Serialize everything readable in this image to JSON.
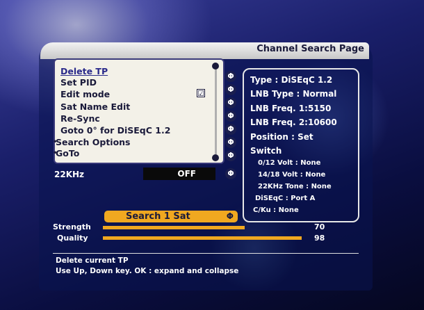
{
  "header": {
    "title": "Channel Search Page"
  },
  "menu": {
    "items": [
      {
        "label": "Delete TP"
      },
      {
        "label": "Set PID"
      },
      {
        "label": "Edit mode"
      },
      {
        "label": "Sat Name Edit"
      },
      {
        "label": "Re-Sync"
      },
      {
        "label": "Goto 0° for DiSEqC 1.2"
      },
      {
        "label": "Search Options"
      },
      {
        "label": "GoTo"
      }
    ],
    "edit_mode_check": "☑"
  },
  "right_icons": [
    "Φ",
    "Φ",
    "Φ",
    "Φ",
    "Φ",
    "Φ",
    "Φ",
    "Φ"
  ],
  "info": {
    "type": "Type : DiSEqC 1.2",
    "lnb_type": "LNB Type : Normal",
    "lnb_freq1": "LNB Freq. 1:5150",
    "lnb_freq2": "LNB Freq. 2:10600",
    "position": "Position : Set",
    "switch": "Switch",
    "switch_items": {
      "v012": "0/12 Volt : None",
      "v1418": "14/18 Volt : None",
      "tone": "22KHz Tone : None",
      "diseqc": "DiSEqC : Port A",
      "cku": "C/Ku : None"
    }
  },
  "khz": {
    "label": "22KHz",
    "value": "OFF"
  },
  "search": {
    "label": "Search 1 Sat",
    "icon": "Φ"
  },
  "strength": {
    "label": "Strength",
    "value": "70",
    "level": 0.7
  },
  "quality": {
    "label": "Quality",
    "value": "98",
    "level": 0.98
  },
  "help": {
    "line1": "Delete current TP",
    "line2": "Use Up, Down key. OK : expand and collapse"
  },
  "colors": {
    "accent": "#f0a820",
    "panel": "#f3f1e8"
  }
}
